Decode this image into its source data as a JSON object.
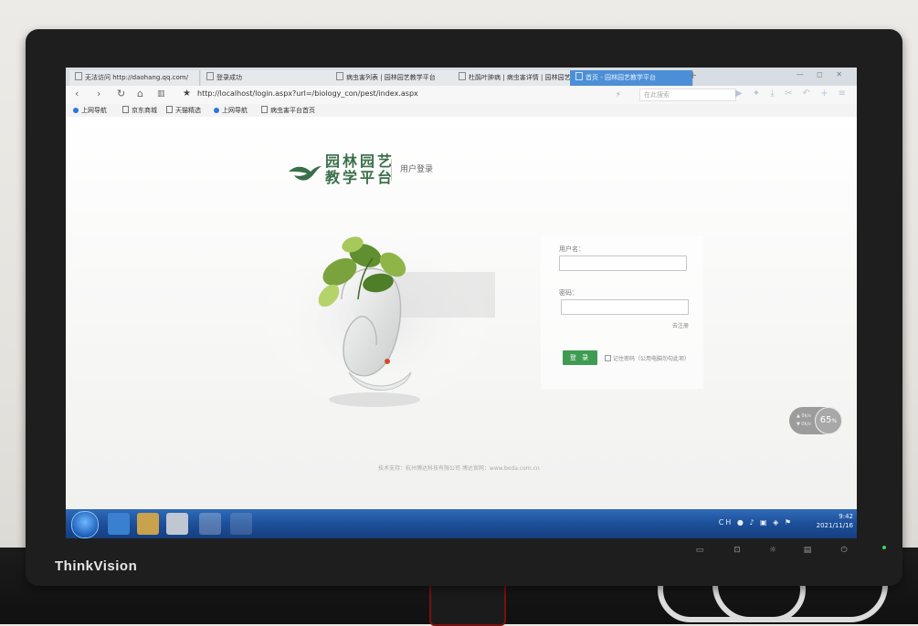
{
  "browser": {
    "tabs": [
      {
        "label": "无法访问 http://daohang.qq.com/"
      },
      {
        "label": "登录成功"
      },
      {
        "label": "病虫害列表 | 园林园艺教学平台"
      },
      {
        "label": "杜鹃叶肿病 | 病虫害详情 | 园林园艺"
      },
      {
        "label": "首页 - 园林园艺教学平台"
      }
    ],
    "url": "http://localhost/login.aspx?url=/biology_con/pest/index.aspx",
    "search_placeholder": "在此搜索",
    "bookmarks": [
      {
        "label": "上网导航"
      },
      {
        "label": "京东商城"
      },
      {
        "label": "天猫精选"
      },
      {
        "label": "上网导航"
      },
      {
        "label": "病虫害平台首页"
      }
    ]
  },
  "page": {
    "logo_line1": "园林园艺",
    "logo_line2": "教学平台",
    "subtitle": "用户登录",
    "username_label": "用户名：",
    "password_label": "密码：",
    "register_link": "去注册",
    "login_button": "登 录",
    "remember_label": "记住密码（公用电脑勿勾此项）",
    "footer": "技术支持：杭州博达科技有限公司 博达官网：www.boda.com.cn",
    "speed_value": "65",
    "speed_unit": "%"
  },
  "taskbar": {
    "tray_lang": "CH",
    "time": "9:42",
    "date": "2021/11/16"
  },
  "monitor": {
    "brand": "ThinkVision"
  },
  "colors": {
    "brand_green": "#3b6f4a",
    "login_button": "#3f9b51",
    "taskbar_blue": "#1d4f99"
  }
}
